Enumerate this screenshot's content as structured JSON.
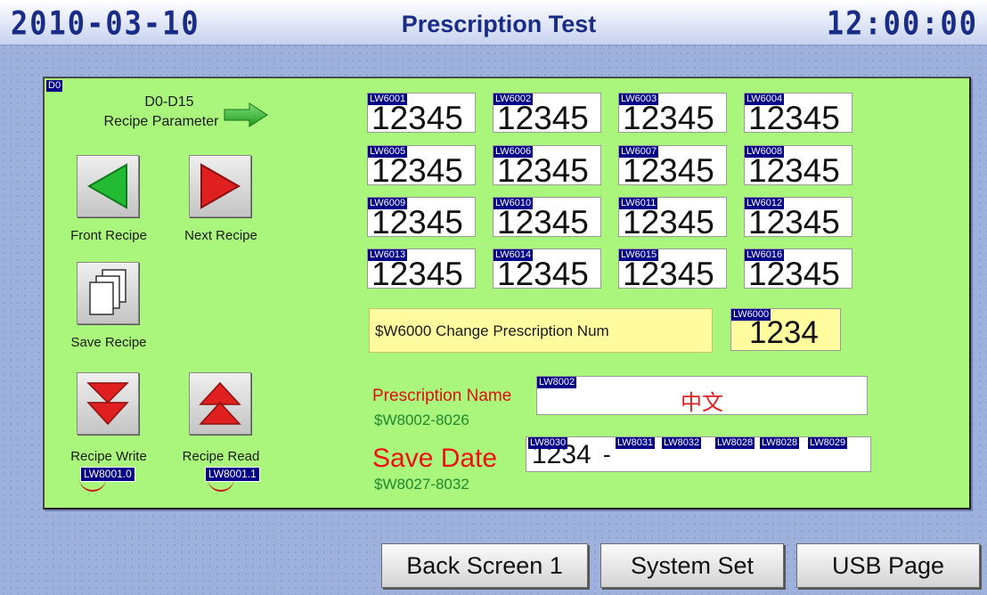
{
  "header": {
    "date": "2010-03-10",
    "title": "Prescription Test",
    "time": "12:00:00"
  },
  "panel": {
    "tag": "D0",
    "range_line1": "D0-D15",
    "range_line2": "Recipe Parameter",
    "buttons": {
      "front": "Front Recipe",
      "next": "Next Recipe",
      "save": "Save Recipe",
      "write": "Recipe Write",
      "read": "Recipe Read"
    },
    "bits": {
      "write": "LW8001.0",
      "read": "LW8001.1"
    },
    "params": [
      {
        "tag": "LW6001",
        "value": "12345"
      },
      {
        "tag": "LW6002",
        "value": "12345"
      },
      {
        "tag": "LW6003",
        "value": "12345"
      },
      {
        "tag": "LW6004",
        "value": "12345"
      },
      {
        "tag": "LW6005",
        "value": "12345"
      },
      {
        "tag": "LW6006",
        "value": "12345"
      },
      {
        "tag": "LW6007",
        "value": "12345"
      },
      {
        "tag": "LW6008",
        "value": "12345"
      },
      {
        "tag": "LW6009",
        "value": "12345"
      },
      {
        "tag": "LW6010",
        "value": "12345"
      },
      {
        "tag": "LW6011",
        "value": "12345"
      },
      {
        "tag": "LW6012",
        "value": "12345"
      },
      {
        "tag": "LW6013",
        "value": "12345"
      },
      {
        "tag": "LW6014",
        "value": "12345"
      },
      {
        "tag": "LW6015",
        "value": "12345"
      },
      {
        "tag": "LW6016",
        "value": "12345"
      }
    ],
    "change": {
      "label": "$W6000 Change Prescription Num",
      "tag": "LW6000",
      "value": "1234"
    },
    "name": {
      "label": "Prescription Name",
      "sub": "$W8002-8026",
      "tag": "LW8002",
      "value": "中文"
    },
    "savedate": {
      "label": "Save Date",
      "sub": "$W8027-8032",
      "tag": "LW8030",
      "value_start": "1234",
      "tags": [
        "LW8031",
        "LW8032",
        "LW8028",
        "LW8028",
        "LW8029"
      ]
    }
  },
  "nav": {
    "back": "Back Screen 1",
    "system": "System Set",
    "usb": "USB Page"
  },
  "colors": {
    "panel": "#aaf57c",
    "header_text": "#1a2d86",
    "tag_bg": "#000088",
    "accent_red": "#cc1a1a",
    "highlight": "#fffca0"
  }
}
